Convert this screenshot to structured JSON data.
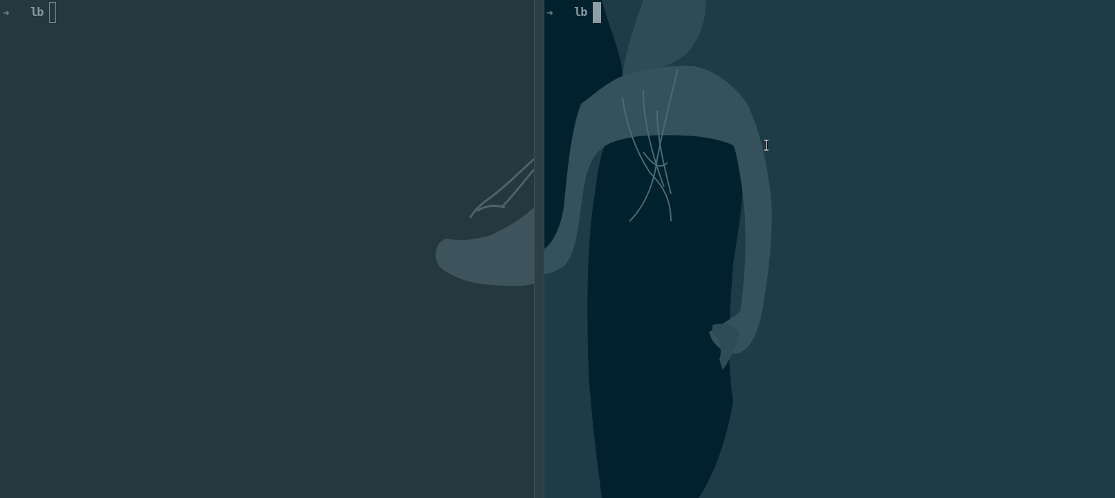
{
  "terminal": {
    "left_pane": {
      "prompt_symbol": "➜",
      "directory": "lb"
    },
    "right_pane": {
      "prompt_symbol": "➜",
      "directory": "lb"
    }
  },
  "colors": {
    "left_background": "#26383f",
    "right_background": "#1f3b47",
    "divider": "#2c3f47",
    "prompt_text": "#879aa0",
    "wallpaper_dress": "#00212d"
  },
  "icons": {
    "prompt": "arrow-right-icon",
    "mouse_pointer": "text-cursor-icon"
  }
}
